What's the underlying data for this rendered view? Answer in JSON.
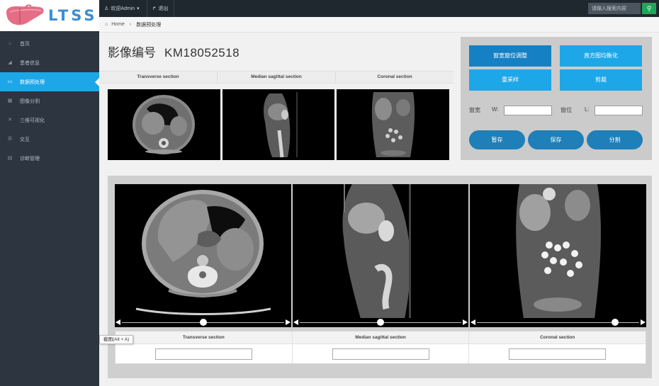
{
  "brand": {
    "logo_text": "LTSS",
    "accent": "#1ea7e8",
    "sidebar_bg": "#2c3540"
  },
  "topbar": {
    "welcome": "欢迎Admin",
    "logout": "退出",
    "search_placeholder": "请输入搜索内容",
    "search_icon": "magnifier-icon"
  },
  "breadcrumb": {
    "home": "Home",
    "current": "数据预处理"
  },
  "sidebar": {
    "items": [
      {
        "label": "首页",
        "icon": "home-icon",
        "active": false
      },
      {
        "label": "患者信息",
        "icon": "chart-icon",
        "active": false
      },
      {
        "label": "数据预处理",
        "icon": "monitor-icon",
        "active": true
      },
      {
        "label": "图像分割",
        "icon": "grid-icon",
        "active": false
      },
      {
        "label": "三维可视化",
        "icon": "expand-icon",
        "active": false
      },
      {
        "label": "交互",
        "icon": "list-icon",
        "active": false
      },
      {
        "label": "诊断管理",
        "icon": "table-icon",
        "active": false
      }
    ]
  },
  "page": {
    "title_label": "影像编号",
    "image_id": "KM18052518"
  },
  "preview": {
    "headers": [
      "Transverse section",
      "Median sagittal section",
      "Coronal section"
    ]
  },
  "controls": {
    "buttons": [
      "窗宽窗位调整",
      "直方图均衡化",
      "重采样",
      "剪裁"
    ],
    "window_width_label": "窗宽",
    "w_label": "W:",
    "window_level_label": "窗位",
    "l_label": "L:",
    "actions": [
      "暂存",
      "保存",
      "分割"
    ]
  },
  "viewer": {
    "sections": [
      "Transverse section",
      "Median sagittal section",
      "Coronal section"
    ],
    "slider_positions": [
      0.5,
      0.5,
      0.85
    ]
  },
  "tooltip": "截图(Alt + A)"
}
